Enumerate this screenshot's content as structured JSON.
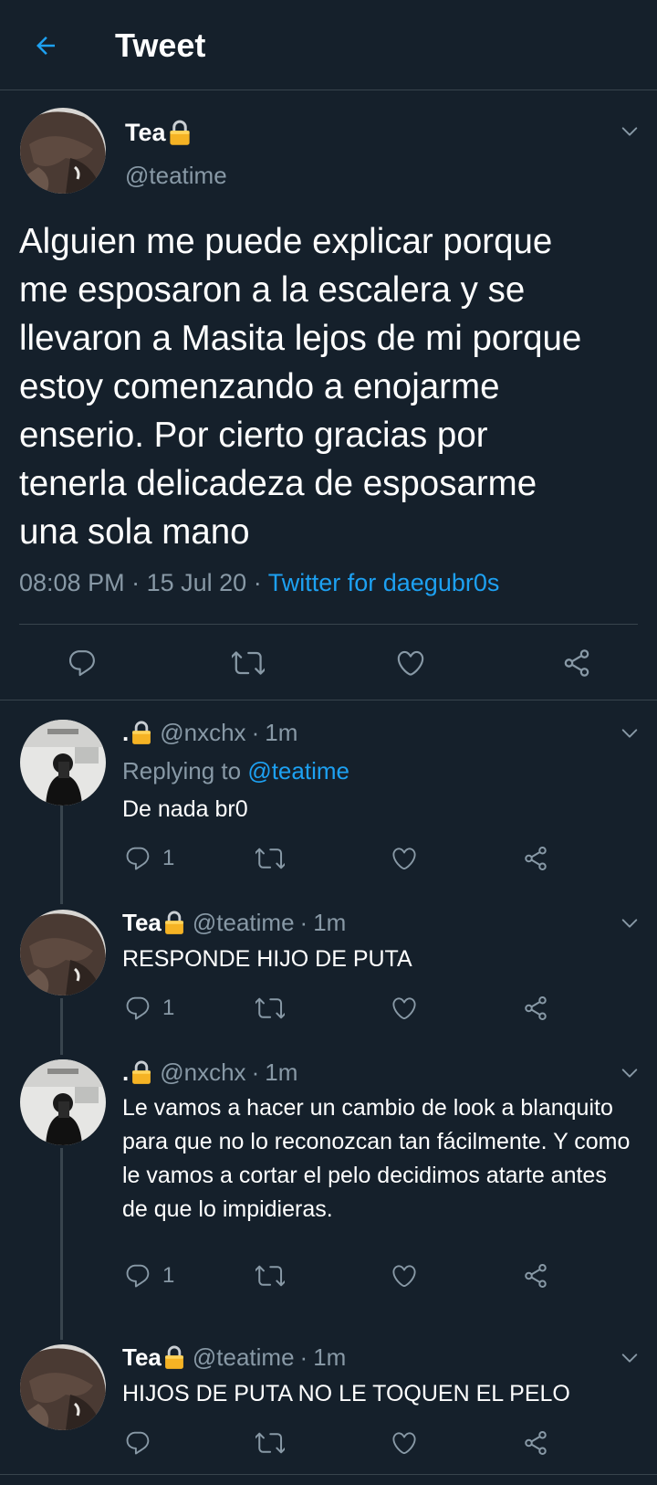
{
  "header": {
    "title": "Tweet"
  },
  "colors": {
    "background": "#15202b",
    "accent": "#1da1f2",
    "muted": "#8899a6",
    "divider": "#38444d",
    "lock": "#f5b324"
  },
  "main_tweet": {
    "name": "Tea",
    "handle": "@teatime",
    "text": "Alguien me puede explicar porque\nme esposaron a la escalera y se\nllevaron a Masita lejos de mi porque\nestoy comenzando a enojarme\nenserio. Por cierto gracias por\ntenerla delicadeza de esposarme\nuna sola mano",
    "time": "08:08 PM",
    "date": "15 Jul 20",
    "source": "Twitter for daegubr0s"
  },
  "replies": [
    {
      "name": ".",
      "handle": "@nxchx",
      "time": "1m",
      "replying_label": "Replying to",
      "replying_mention": "@teatime",
      "text": "De nada br0",
      "reply_count": "1"
    },
    {
      "name": "Tea",
      "handle": "@teatime",
      "time": "1m",
      "text": "RESPONDE HIJO DE PUTA",
      "reply_count": "1"
    },
    {
      "name": ".",
      "handle": "@nxchx",
      "time": "1m",
      "text": "Le vamos a hacer un cambio de look a blanquito para que no lo reconozcan tan fácilmente. Y como le vamos a cortar el pelo decidimos atarte antes de que lo impidieras.",
      "reply_count": "1"
    },
    {
      "name": "Tea",
      "handle": "@teatime",
      "time": "1m",
      "text": "HIJOS DE PUTA NO LE TOQUEN EL PELO",
      "reply_count": ""
    }
  ],
  "separators": {
    "dot": "·"
  },
  "icons": [
    "back-arrow-icon",
    "chevron-down-icon",
    "lock-icon",
    "reply-icon",
    "retweet-icon",
    "like-icon",
    "share-icon"
  ]
}
